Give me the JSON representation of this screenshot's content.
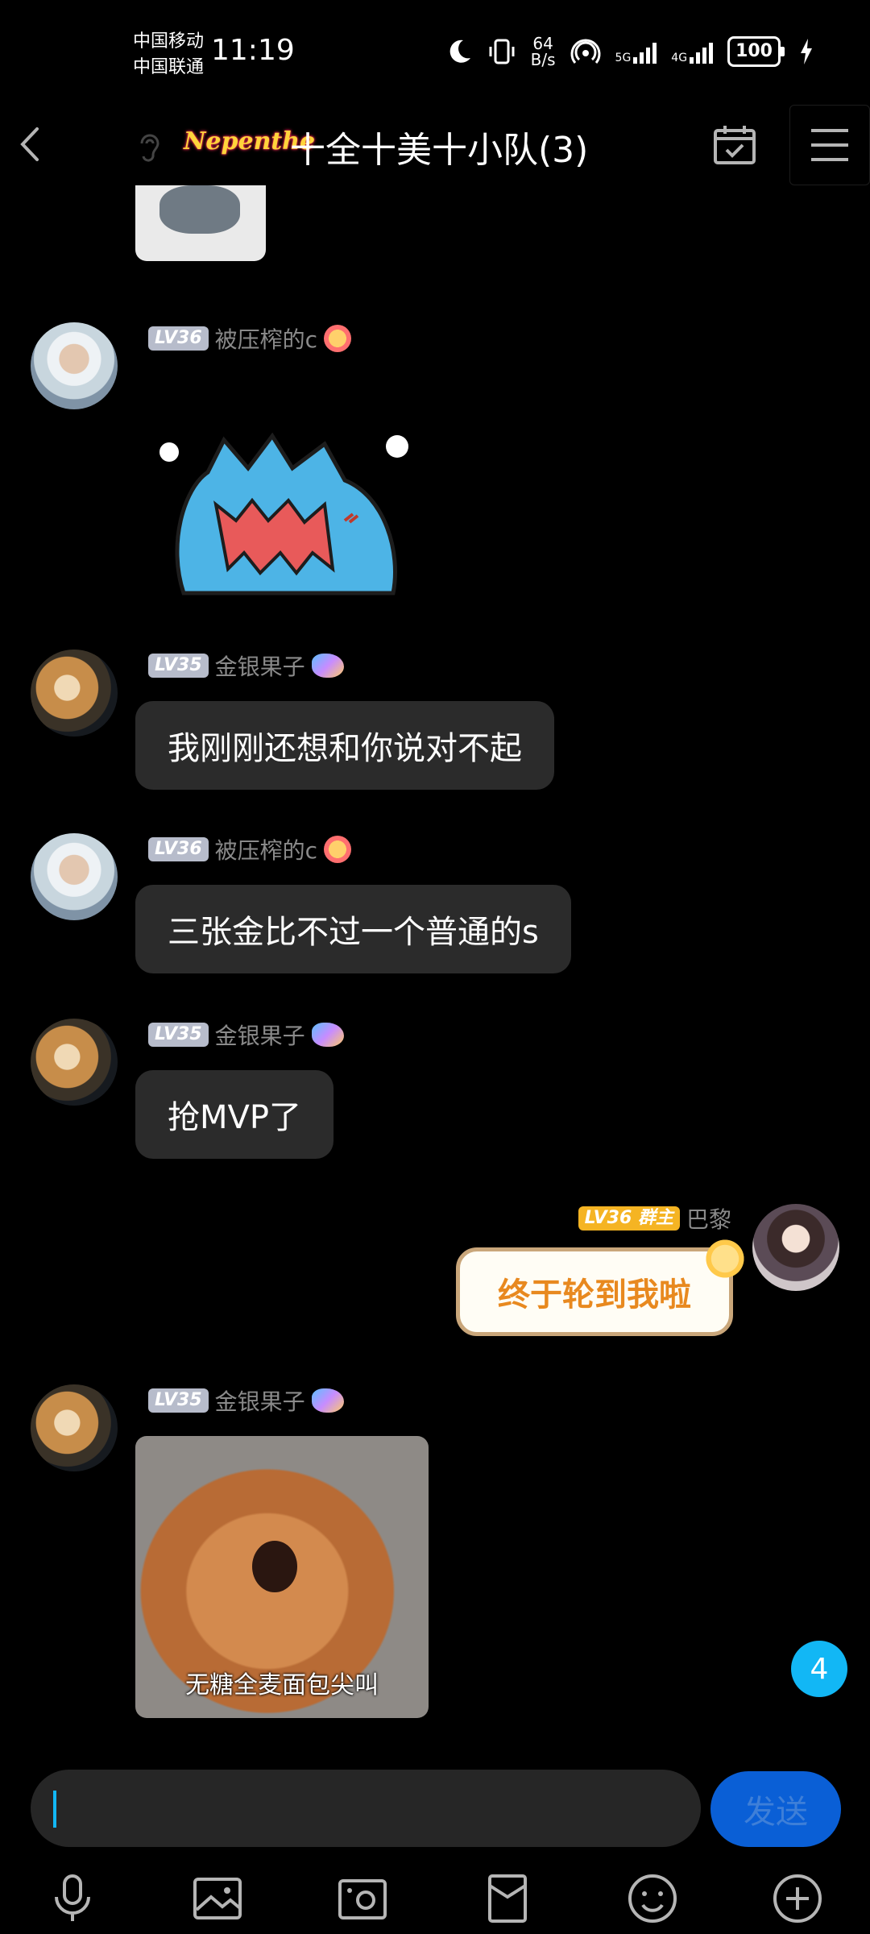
{
  "status_bar": {
    "carrier_1": "中国移动",
    "carrier_2": "中国联通",
    "time": "11:19",
    "net_speed_value": "64",
    "net_speed_unit": "B/s",
    "signal_1_type": "5G",
    "signal_2_type": "4G",
    "battery": "100"
  },
  "header": {
    "badge": "Nepenthe",
    "title": "十全十美十小队(3)"
  },
  "messages": [
    {
      "sender": "被压榨的c",
      "level": "LV36",
      "kind": "sticker"
    },
    {
      "sender": "金银果子",
      "level": "LV35",
      "text": "我刚刚还想和你说对不起"
    },
    {
      "sender": "被压榨的c",
      "level": "LV36",
      "text": "三张金比不过一个普通的s"
    },
    {
      "sender": "金银果子",
      "level": "LV35",
      "text": "抢MVP了"
    },
    {
      "sender": "巴黎",
      "level": "LV36",
      "role": "群主",
      "text": "终于轮到我啦"
    },
    {
      "sender": "金银果子",
      "level": "LV35",
      "kind": "image",
      "caption": "无糖全麦面包尖叫"
    }
  ],
  "unread_count": "4",
  "input": {
    "send_label": "发送"
  },
  "colors": {
    "accent": "#12b7f5",
    "send": "#0a5fd6",
    "bubble": "#2b2b2b",
    "owner_badge": "#f5b423"
  }
}
